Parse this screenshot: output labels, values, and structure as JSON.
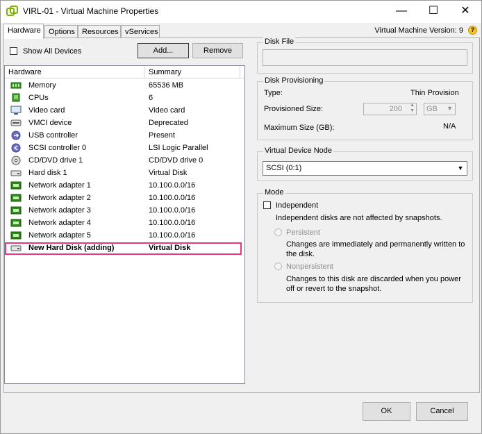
{
  "window": {
    "title": "VIRL-01 - Virtual Machine Properties",
    "minimize_symbol": "—",
    "maximize_symbol": "☐",
    "close_symbol": "✕"
  },
  "tabs": [
    {
      "label": "Hardware",
      "active": true
    },
    {
      "label": "Options",
      "active": false
    },
    {
      "label": "Resources",
      "active": false
    },
    {
      "label": "vServices",
      "active": false
    }
  ],
  "vm_version": "Virtual Machine Version: 9",
  "help_symbol": "?",
  "hardware_panel": {
    "show_all_devices_label": "Show All Devices",
    "show_all_devices_checked": false,
    "add_button": "Add...",
    "remove_button": "Remove",
    "columns": [
      "Hardware",
      "Summary"
    ],
    "rows": [
      {
        "name": "Memory",
        "summary": "65536 MB",
        "icon": "memory-icon"
      },
      {
        "name": "CPUs",
        "summary": "6",
        "icon": "cpu-icon"
      },
      {
        "name": "Video card",
        "summary": "Video card",
        "icon": "video-card-icon"
      },
      {
        "name": "VMCI device",
        "summary": "Deprecated",
        "icon": "vmci-device-icon"
      },
      {
        "name": "USB controller",
        "summary": "Present",
        "icon": "usb-controller-icon"
      },
      {
        "name": "SCSI controller 0",
        "summary": "LSI Logic Parallel",
        "icon": "scsi-controller-icon"
      },
      {
        "name": "CD/DVD drive 1",
        "summary": "CD/DVD drive 0",
        "icon": "cd-dvd-icon"
      },
      {
        "name": "Hard disk 1",
        "summary": "Virtual Disk",
        "icon": "hard-disk-icon"
      },
      {
        "name": "Network adapter 1",
        "summary": "10.100.0.0/16",
        "icon": "network-adapter-icon"
      },
      {
        "name": "Network adapter 2",
        "summary": "10.100.0.0/16",
        "icon": "network-adapter-icon"
      },
      {
        "name": "Network adapter 3",
        "summary": "10.100.0.0/16",
        "icon": "network-adapter-icon"
      },
      {
        "name": "Network adapter 4",
        "summary": "10.100.0.0/16",
        "icon": "network-adapter-icon"
      },
      {
        "name": "Network adapter 5",
        "summary": "10.100.0.0/16",
        "icon": "network-adapter-icon"
      },
      {
        "name": "New Hard Disk (adding)",
        "summary": "Virtual Disk",
        "icon": "hard-disk-icon",
        "selected": true
      }
    ]
  },
  "disk_file": {
    "title": "Disk File",
    "value": ""
  },
  "disk_provisioning": {
    "title": "Disk Provisioning",
    "type_label": "Type:",
    "type_value": "Thin Provision",
    "provisioned_label": "Provisioned Size:",
    "provisioned_value": "200",
    "unit_value": "GB",
    "max_size_label": "Maximum Size (GB):",
    "max_size_value": "N/A"
  },
  "virtual_device_node": {
    "title": "Virtual Device Node",
    "selected": "SCSI (0:1)"
  },
  "mode": {
    "title": "Mode",
    "independent_label": "Independent",
    "independent_checked": false,
    "independent_desc": "Independent disks are not affected by snapshots.",
    "persistent_label": "Persistent",
    "persistent_desc_1": "Changes are immediately and permanently written to",
    "persistent_desc_2": "the disk.",
    "nonpersistent_label": "Nonpersistent",
    "nonpersistent_desc_1": "Changes to this disk are discarded when you power",
    "nonpersistent_desc_2": "off or revert to the snapshot."
  },
  "footer": {
    "ok_button": "OK",
    "cancel_button": "Cancel"
  },
  "colors": {
    "selection_highlight": "#e8377a",
    "network_icon": "#2e8b1a",
    "memory_icon": "#3a9a2a"
  }
}
